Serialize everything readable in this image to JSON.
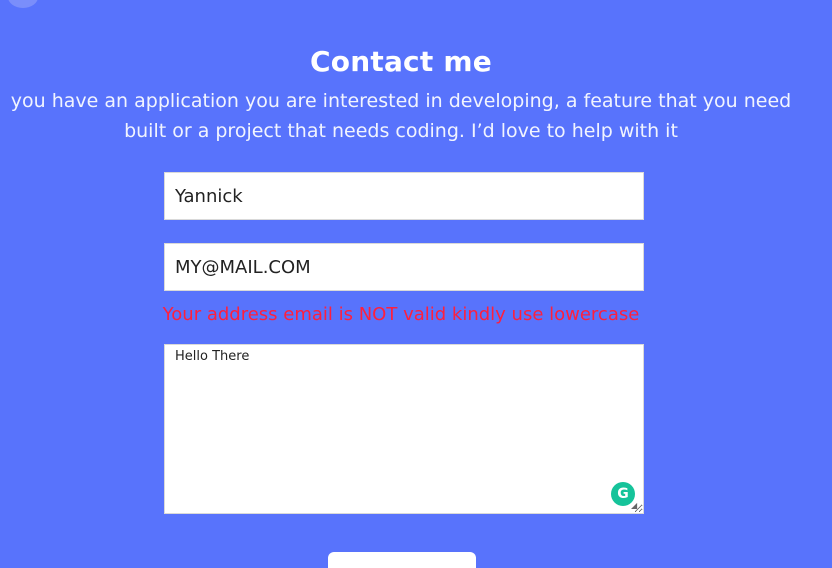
{
  "page": {
    "title": "Contact me",
    "intro": "you have an application you are interested in developing, a feature that you need built or a project that needs coding. I’d love to help with it"
  },
  "form": {
    "name_value": "Yannick",
    "email_value": "MY@MAIL.COM",
    "email_error": "Your address email is NOT valid kindly use lowercase",
    "message_value": "Hello There",
    "submit_label": ""
  },
  "colors": {
    "background": "#5873fc",
    "error": "#ff1f3d",
    "grammarly": "#15c39a"
  },
  "icons": {
    "grammarly": "grammarly-g-icon",
    "resize": "textarea-resize-icon"
  }
}
